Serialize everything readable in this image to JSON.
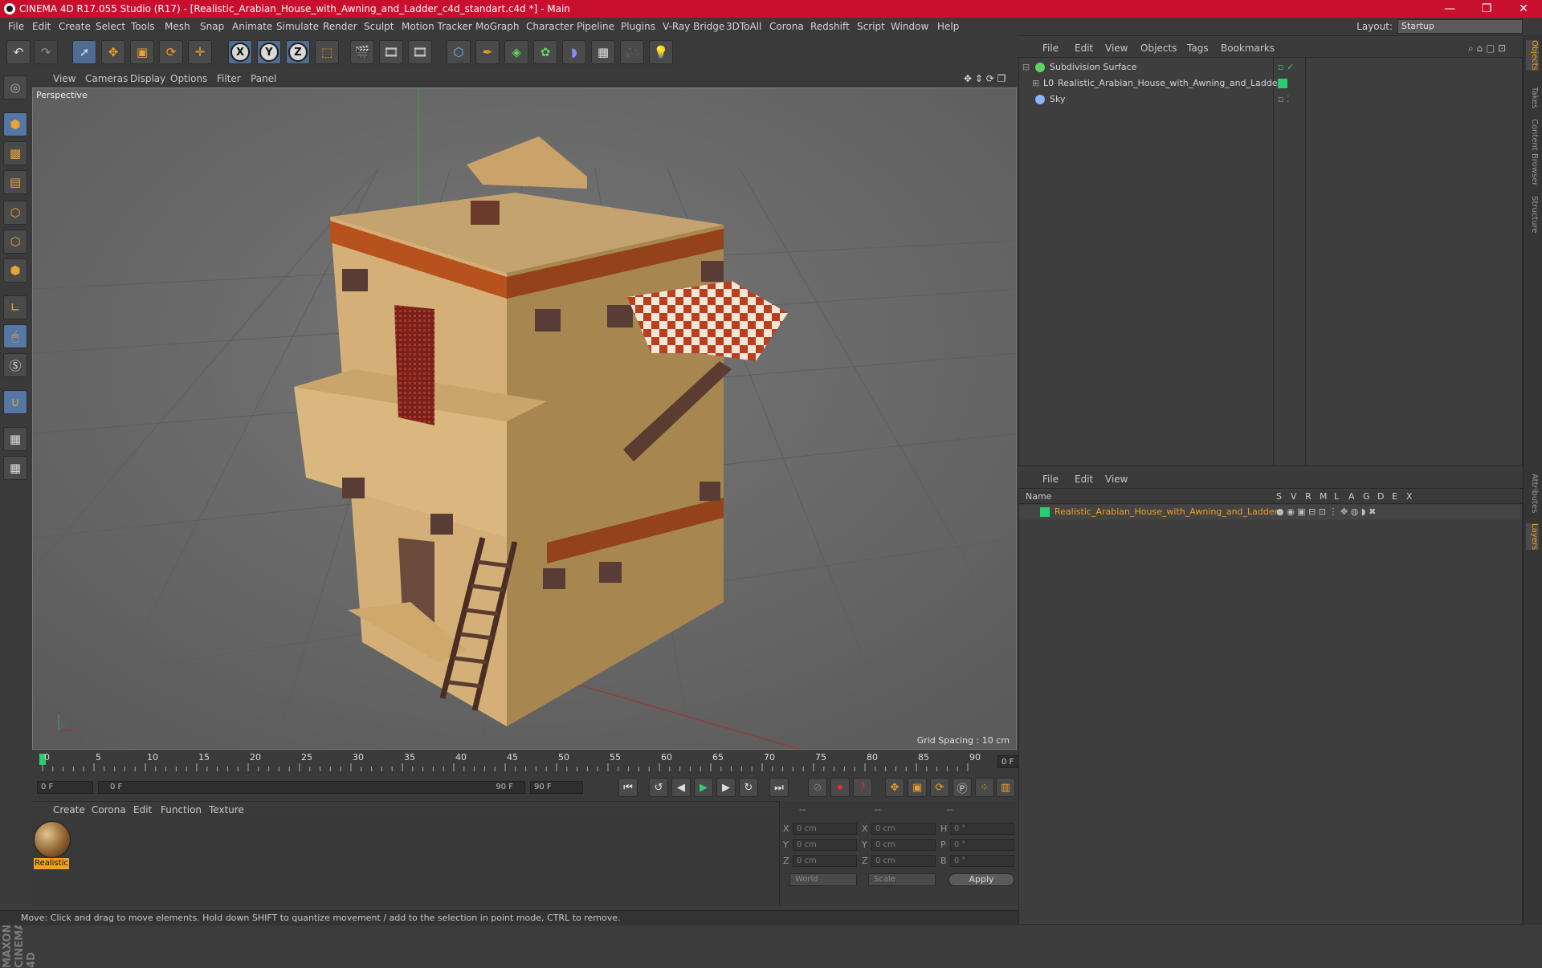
{
  "window": {
    "title": "CINEMA 4D R17.055 Studio (R17) - [Realistic_Arabian_House_with_Awning_and_Ladder_c4d_standart.c4d *] - Main",
    "minimize": "—",
    "maximize": "❐",
    "close": "✕"
  },
  "menubar": {
    "items": [
      "File",
      "Edit",
      "Create",
      "Select",
      "Tools",
      "Mesh",
      "Snap",
      "Animate",
      "Simulate",
      "Render",
      "Sculpt",
      "Motion Tracker",
      "MoGraph",
      "Character",
      "Pipeline",
      "Plugins",
      "V-Ray Bridge",
      "3DToAll",
      "Corona",
      "Redshift",
      "Script",
      "Window",
      "Help"
    ],
    "layout_label": "Layout:",
    "layout_value": "Startup"
  },
  "toolbar": {
    "axis_x": "X",
    "axis_y": "Y",
    "axis_z": "Z"
  },
  "viewport": {
    "menu": [
      "View",
      "Cameras",
      "Display",
      "Options",
      "Filter",
      "Panel"
    ],
    "label": "Perspective",
    "grid_spacing": "Grid Spacing : 10 cm"
  },
  "timeline": {
    "ticks": [
      "0",
      "5",
      "10",
      "15",
      "20",
      "25",
      "30",
      "35",
      "40",
      "45",
      "50",
      "55",
      "60",
      "65",
      "70",
      "75",
      "80",
      "85",
      "90"
    ],
    "current_frame": "0 F"
  },
  "transport": {
    "start_field": "0 F",
    "range_start": "0 F",
    "range_end": "90 F",
    "end_field": "90 F"
  },
  "material_manager": {
    "menu": [
      "Create",
      "Corona",
      "Edit",
      "Function",
      "Texture"
    ],
    "materials": [
      {
        "name": "Realistic"
      }
    ]
  },
  "coordinates": {
    "header": [
      "--",
      "--",
      "--"
    ],
    "rows": [
      {
        "a": "X",
        "av": "0 cm",
        "b": "X",
        "bv": "0 cm",
        "c": "H",
        "cv": "0 °"
      },
      {
        "a": "Y",
        "av": "0 cm",
        "b": "Y",
        "bv": "0 cm",
        "c": "P",
        "cv": "0 °"
      },
      {
        "a": "Z",
        "av": "0 cm",
        "b": "Z",
        "bv": "0 cm",
        "c": "B",
        "cv": "0 °"
      }
    ],
    "space": "World",
    "mode": "Scale",
    "apply": "Apply"
  },
  "status": {
    "text": "Move: Click and drag to move elements. Hold down SHIFT to quantize movement / add to the selection in point mode, CTRL to remove."
  },
  "object_manager": {
    "menu": [
      "File",
      "Edit",
      "View",
      "Objects",
      "Tags",
      "Bookmarks"
    ],
    "objects": [
      {
        "name": "Subdivision Surface"
      },
      {
        "name": "Realistic_Arabian_House_with_Awning_and_Ladder"
      },
      {
        "name": "Sky"
      }
    ]
  },
  "layer_manager": {
    "menu": [
      "File",
      "Edit",
      "View"
    ],
    "columns": [
      "Name",
      "S",
      "V",
      "R",
      "M",
      "L",
      "A",
      "G",
      "D",
      "E",
      "X"
    ],
    "layers": [
      {
        "name": "Realistic_Arabian_House_with_Awning_and_Ladder"
      }
    ]
  },
  "side_tabs": [
    "Objects",
    "Takes",
    "Content Browser",
    "Structure",
    "Attributes",
    "Layers"
  ],
  "colors": {
    "title_bar": "#c8102e",
    "accent": "#f0a028",
    "layer_green": "#2ecc71"
  }
}
